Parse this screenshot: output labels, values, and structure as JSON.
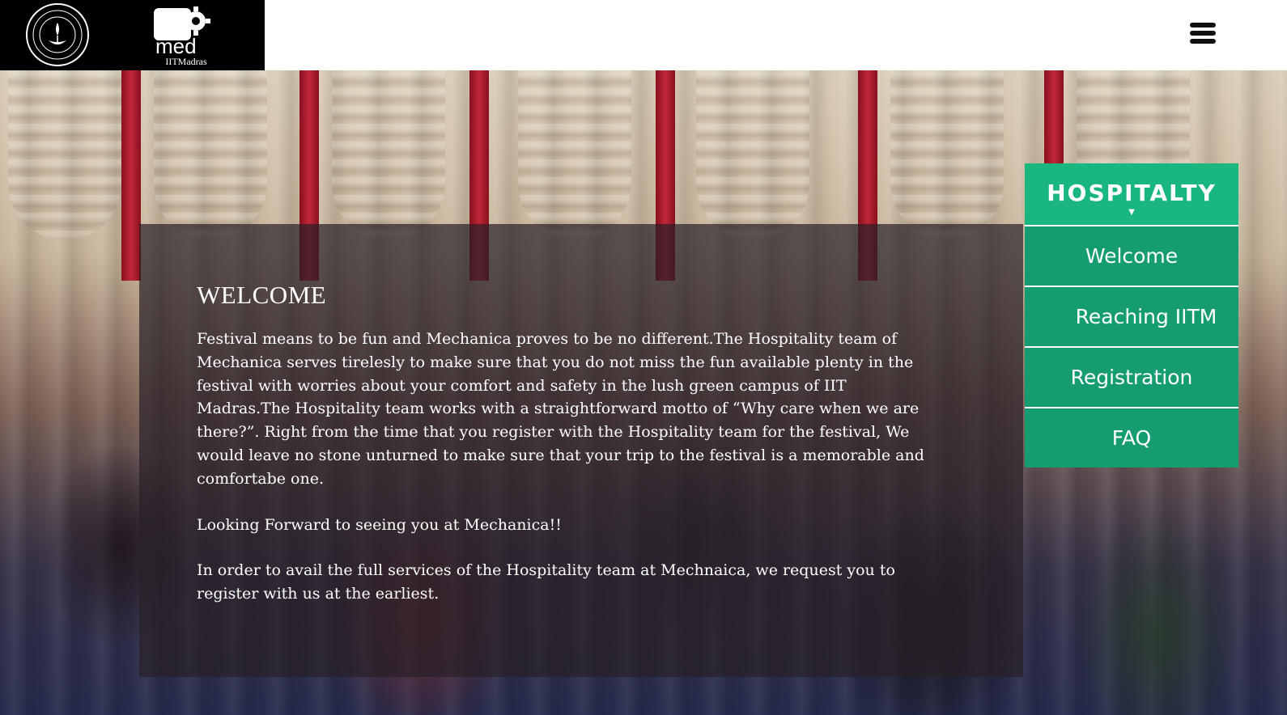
{
  "header": {
    "logo_text": "IITMadras",
    "menu_icon": "hamburger-menu-icon"
  },
  "welcome": {
    "title": "WELCOME",
    "paragraphs": [
      "Festival means to be fun and Mechanica proves to be no different.The Hospitality team of Mechanica serves tirelesly to make sure that you do not miss the fun available plenty in the festival with worries about your comfort and safety in the lush green campus of IIT Madras.The Hospitality team works with a straightforward motto of “Why care when we are there?”. Right from the time that you register with the Hospitality team for the festival, We would leave no stone unturned to make sure that your trip to the festival is a memorable and comfortabe one.",
      "Looking Forward to seeing you at Mechanica!!",
      "In order to avail the full services of the Hospitality team at Mechnaica, we request you to register with us at the earliest."
    ]
  },
  "side_menu": {
    "title": "HOSPITALTY",
    "arrow": "▼",
    "items": [
      {
        "label": "Welcome"
      },
      {
        "label": "Reaching IITM"
      },
      {
        "label": "Registration"
      },
      {
        "label": "FAQ"
      }
    ]
  },
  "colors": {
    "menu_head": "#1ab67f",
    "menu_item": "#159c70",
    "panel": "rgba(40,32,38,0.70)"
  }
}
